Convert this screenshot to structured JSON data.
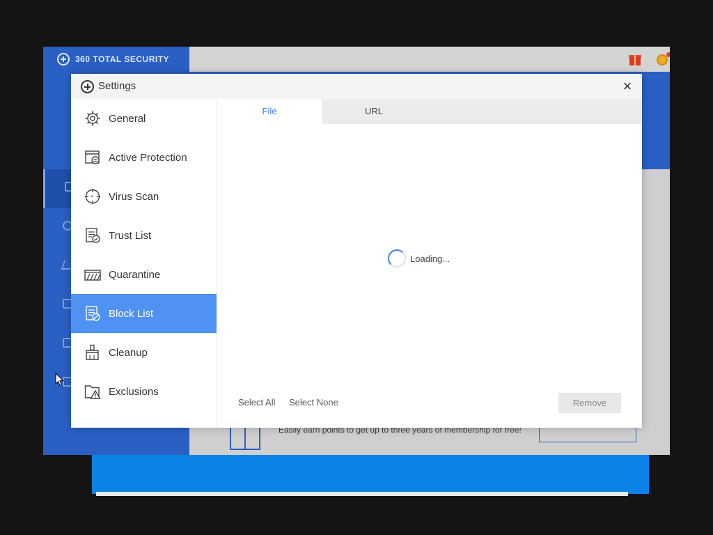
{
  "background_app": {
    "brand": "360 TOTAL SECURITY",
    "promo_text": "Easily earn points to get up to three years of membership for free!",
    "toolbar_icons": [
      "gift-icon",
      "coin-icon",
      "shirt-icon",
      "menu-icon",
      "minimize-icon",
      "maximize-icon",
      "close-icon"
    ]
  },
  "dialog": {
    "title": "Settings",
    "close_glyph": "×",
    "nav": [
      {
        "label": "General",
        "icon": "gear-icon"
      },
      {
        "label": "Active Protection",
        "icon": "shield-window-icon"
      },
      {
        "label": "Virus Scan",
        "icon": "crosshair-icon"
      },
      {
        "label": "Trust List",
        "icon": "document-check-icon"
      },
      {
        "label": "Quarantine",
        "icon": "quarantine-icon"
      },
      {
        "label": "Block List",
        "icon": "document-block-icon",
        "active": true
      },
      {
        "label": "Cleanup",
        "icon": "broom-icon"
      },
      {
        "label": "Exclusions",
        "icon": "folder-warning-icon"
      }
    ],
    "tabs": [
      {
        "label": "File",
        "active": true
      },
      {
        "label": "URL",
        "active": false
      }
    ],
    "loading_text": "Loading...",
    "select_all": "Select All",
    "select_none": "Select None",
    "remove": "Remove"
  },
  "colors": {
    "accent": "#4f92f4",
    "brand_blue": "#2a5fc4",
    "tab_active_text": "#3b82f6"
  }
}
